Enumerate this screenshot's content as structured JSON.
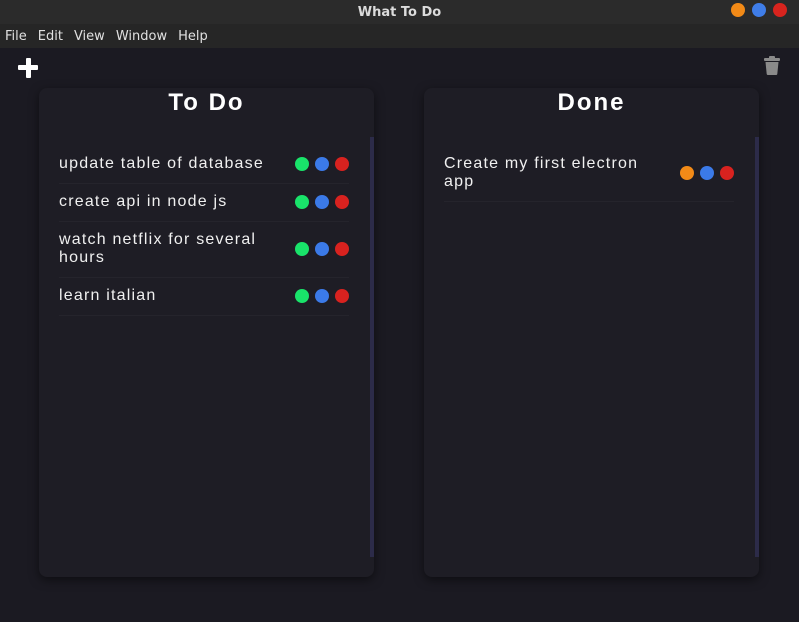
{
  "window": {
    "title": "What To Do",
    "controls_colors": [
      "#f28a17",
      "#3f7de8",
      "#d8241e"
    ]
  },
  "menubar": {
    "items": [
      "File",
      "Edit",
      "View",
      "Window",
      "Help"
    ]
  },
  "toolbar": {
    "add_icon": "plus-icon",
    "delete_icon": "trash-icon"
  },
  "todo": {
    "title": "To Do",
    "items": [
      {
        "text": "update table of database",
        "actions": [
          "green-done",
          "blue-edit",
          "red-delete"
        ]
      },
      {
        "text": "create api in node js",
        "actions": [
          "green-done",
          "blue-edit",
          "red-delete"
        ]
      },
      {
        "text": "watch netflix for several hours",
        "actions": [
          "green-done",
          "blue-edit",
          "red-delete"
        ]
      },
      {
        "text": "learn italian",
        "actions": [
          "green-done",
          "blue-edit",
          "red-delete"
        ]
      }
    ]
  },
  "done": {
    "title": "Done",
    "items": [
      {
        "text": "Create my first electron app",
        "actions": [
          "orange-undo",
          "blue-edit",
          "red-delete"
        ]
      }
    ]
  },
  "colors": {
    "green": "#19e36a",
    "blue": "#3b7ae8",
    "red": "#d8221f",
    "orange": "#f28a17",
    "background": "#1b1a22",
    "panel": "#1e1d25"
  }
}
